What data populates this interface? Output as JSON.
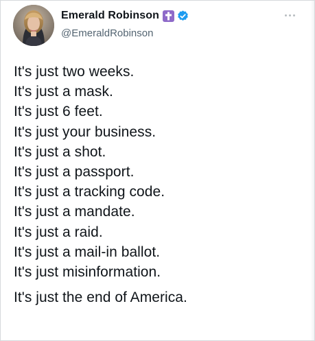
{
  "account": {
    "display_name": "Emerald Robinson",
    "handle": "@EmeraldRobinson",
    "cross_badge_icon": "cross-icon",
    "verified_icon": "verified-badge-icon",
    "accent_color": "#1d9bf0",
    "cross_badge_color": "#8e6ac9"
  },
  "tweet": {
    "lines": [
      "It's just two weeks.",
      "It's just a mask.",
      "It's just 6 feet.",
      "It's just your business.",
      "It's just a shot.",
      "It's just a passport.",
      "It's just a tracking code.",
      "It's just a mandate.",
      "It's just a raid.",
      "It's just a mail-in ballot.",
      "It's just misinformation."
    ],
    "final_line": "It's just the end of America."
  },
  "actions": {
    "more_icon": "more-options-icon"
  }
}
